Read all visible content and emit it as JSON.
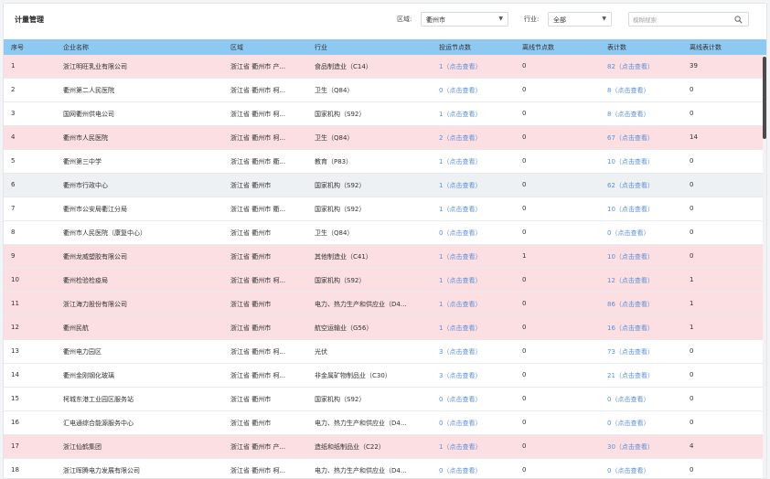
{
  "header": {
    "title": "计量管理",
    "region_label": "区域:",
    "region_value": "衢州市",
    "industry_label": "行业:",
    "industry_value": "全部",
    "search_placeholder": "模糊搜索"
  },
  "columns": [
    "序号",
    "企业名称",
    "区域",
    "行业",
    "投运节点数",
    "离线节点数",
    "表计数",
    "离线表计数"
  ],
  "rows": [
    {
      "no": "1",
      "name": "浙江明旺乳业有限公司",
      "region": "浙江省 衢州市 产...",
      "industry": "食品制造业（C14）",
      "nodes": "1（点击查看）",
      "offline_nodes": "0",
      "meters": "82（点击查看）",
      "offline_meters": "39",
      "style": "pink"
    },
    {
      "no": "2",
      "name": "衢州第二人民医院",
      "region": "浙江省 衢州市 柯...",
      "industry": "卫生（Q84）",
      "nodes": "0（点击查看）",
      "offline_nodes": "0",
      "meters": "8（点击查看）",
      "offline_meters": "0",
      "style": "white"
    },
    {
      "no": "3",
      "name": "国网衢州供电公司",
      "region": "浙江省 衢州市 柯...",
      "industry": "国家机构（S92）",
      "nodes": "1（点击查看）",
      "offline_nodes": "0",
      "meters": "8（点击查看）",
      "offline_meters": "0",
      "style": "white"
    },
    {
      "no": "4",
      "name": "衢州市人民医院",
      "region": "浙江省 衢州市 柯...",
      "industry": "卫生（Q84）",
      "nodes": "2（点击查看）",
      "offline_nodes": "0",
      "meters": "67（点击查看）",
      "offline_meters": "14",
      "style": "pink"
    },
    {
      "no": "5",
      "name": "衢州第三中学",
      "region": "浙江省 衢州市 衢...",
      "industry": "教育（P83）",
      "nodes": "1（点击查看）",
      "offline_nodes": "0",
      "meters": "10（点击查看）",
      "offline_meters": "0",
      "style": "white"
    },
    {
      "no": "6",
      "name": "衢州市行政中心",
      "region": "浙江省 衢州市",
      "industry": "国家机构（S92）",
      "nodes": "1（点击查看）",
      "offline_nodes": "0",
      "meters": "62（点击查看）",
      "offline_meters": "0",
      "style": "gray"
    },
    {
      "no": "7",
      "name": "衢州市公安局衢江分局",
      "region": "浙江省 衢州市 衢...",
      "industry": "国家机构（S92）",
      "nodes": "1（点击查看）",
      "offline_nodes": "0",
      "meters": "10（点击查看）",
      "offline_meters": "0",
      "style": "white"
    },
    {
      "no": "8",
      "name": "衢州市人民医院（康复中心）",
      "region": "浙江省 衢州市",
      "industry": "卫生（Q84）",
      "nodes": "0（点击查看）",
      "offline_nodes": "0",
      "meters": "0（点击查看）",
      "offline_meters": "0",
      "style": "white"
    },
    {
      "no": "9",
      "name": "衢州龙威塑胶有限公司",
      "region": "浙江省 衢州市",
      "industry": "其他制造业（C41）",
      "nodes": "1（点击查看）",
      "offline_nodes": "1",
      "meters": "10（点击查看）",
      "offline_meters": "0",
      "style": "pink"
    },
    {
      "no": "10",
      "name": "衢州检验检疫局",
      "region": "浙江省 衢州市 柯...",
      "industry": "国家机构（S92）",
      "nodes": "1（点击查看）",
      "offline_nodes": "0",
      "meters": "12（点击查看）",
      "offline_meters": "1",
      "style": "pink"
    },
    {
      "no": "11",
      "name": "浙江海力股份有限公司",
      "region": "浙江省 衢州市",
      "industry": "电力、热力生产和供应业（D4...",
      "nodes": "1（点击查看）",
      "offline_nodes": "0",
      "meters": "86（点击查看）",
      "offline_meters": "1",
      "style": "pink"
    },
    {
      "no": "12",
      "name": "衢州民航",
      "region": "浙江省 衢州市",
      "industry": "航空运输业（G56）",
      "nodes": "1（点击查看）",
      "offline_nodes": "0",
      "meters": "16（点击查看）",
      "offline_meters": "1",
      "style": "pink"
    },
    {
      "no": "13",
      "name": "衢州电力园区",
      "region": "浙江省 衢州市 柯...",
      "industry": "光伏",
      "nodes": "3（点击查看）",
      "offline_nodes": "0",
      "meters": "73（点击查看）",
      "offline_meters": "0",
      "style": "white"
    },
    {
      "no": "14",
      "name": "衢州金刚钢化玻璃",
      "region": "浙江省 衢州市 柯...",
      "industry": "非金属矿物制品业（C30）",
      "nodes": "3（点击查看）",
      "offline_nodes": "0",
      "meters": "21（点击查看）",
      "offline_meters": "0",
      "style": "white"
    },
    {
      "no": "15",
      "name": "柯城东港工业园区服务站",
      "region": "浙江省 衢州市",
      "industry": "国家机构（S92）",
      "nodes": "0（点击查看）",
      "offline_nodes": "0",
      "meters": "0（点击查看）",
      "offline_meters": "0",
      "style": "white"
    },
    {
      "no": "16",
      "name": "汇电通综合能源服务中心",
      "region": "浙江省 衢州市",
      "industry": "电力、热力生产和供应业（D4...",
      "nodes": "0（点击查看）",
      "offline_nodes": "0",
      "meters": "0（点击查看）",
      "offline_meters": "0",
      "style": "white"
    },
    {
      "no": "17",
      "name": "浙江仙鹤集团",
      "region": "浙江省 衢州市 产...",
      "industry": "造纸和纸制品业（C22）",
      "nodes": "1（点击查看）",
      "offline_nodes": "0",
      "meters": "30（点击查看）",
      "offline_meters": "4",
      "style": "pink"
    },
    {
      "no": "18",
      "name": "浙江晖腾电力发展有限公司",
      "region": "浙江省 衢州市 柯...",
      "industry": "电力、热力生产和供应业（D4...",
      "nodes": "0（点击查看）",
      "offline_nodes": "0",
      "meters": "0（点击查看）",
      "offline_meters": "0",
      "style": "white"
    }
  ],
  "colors": {
    "header_bg": "#8ec9f2",
    "row_alert_bg": "#fbdfe2",
    "row_selected_bg": "#eef1f4",
    "link": "#5b8fd8"
  }
}
